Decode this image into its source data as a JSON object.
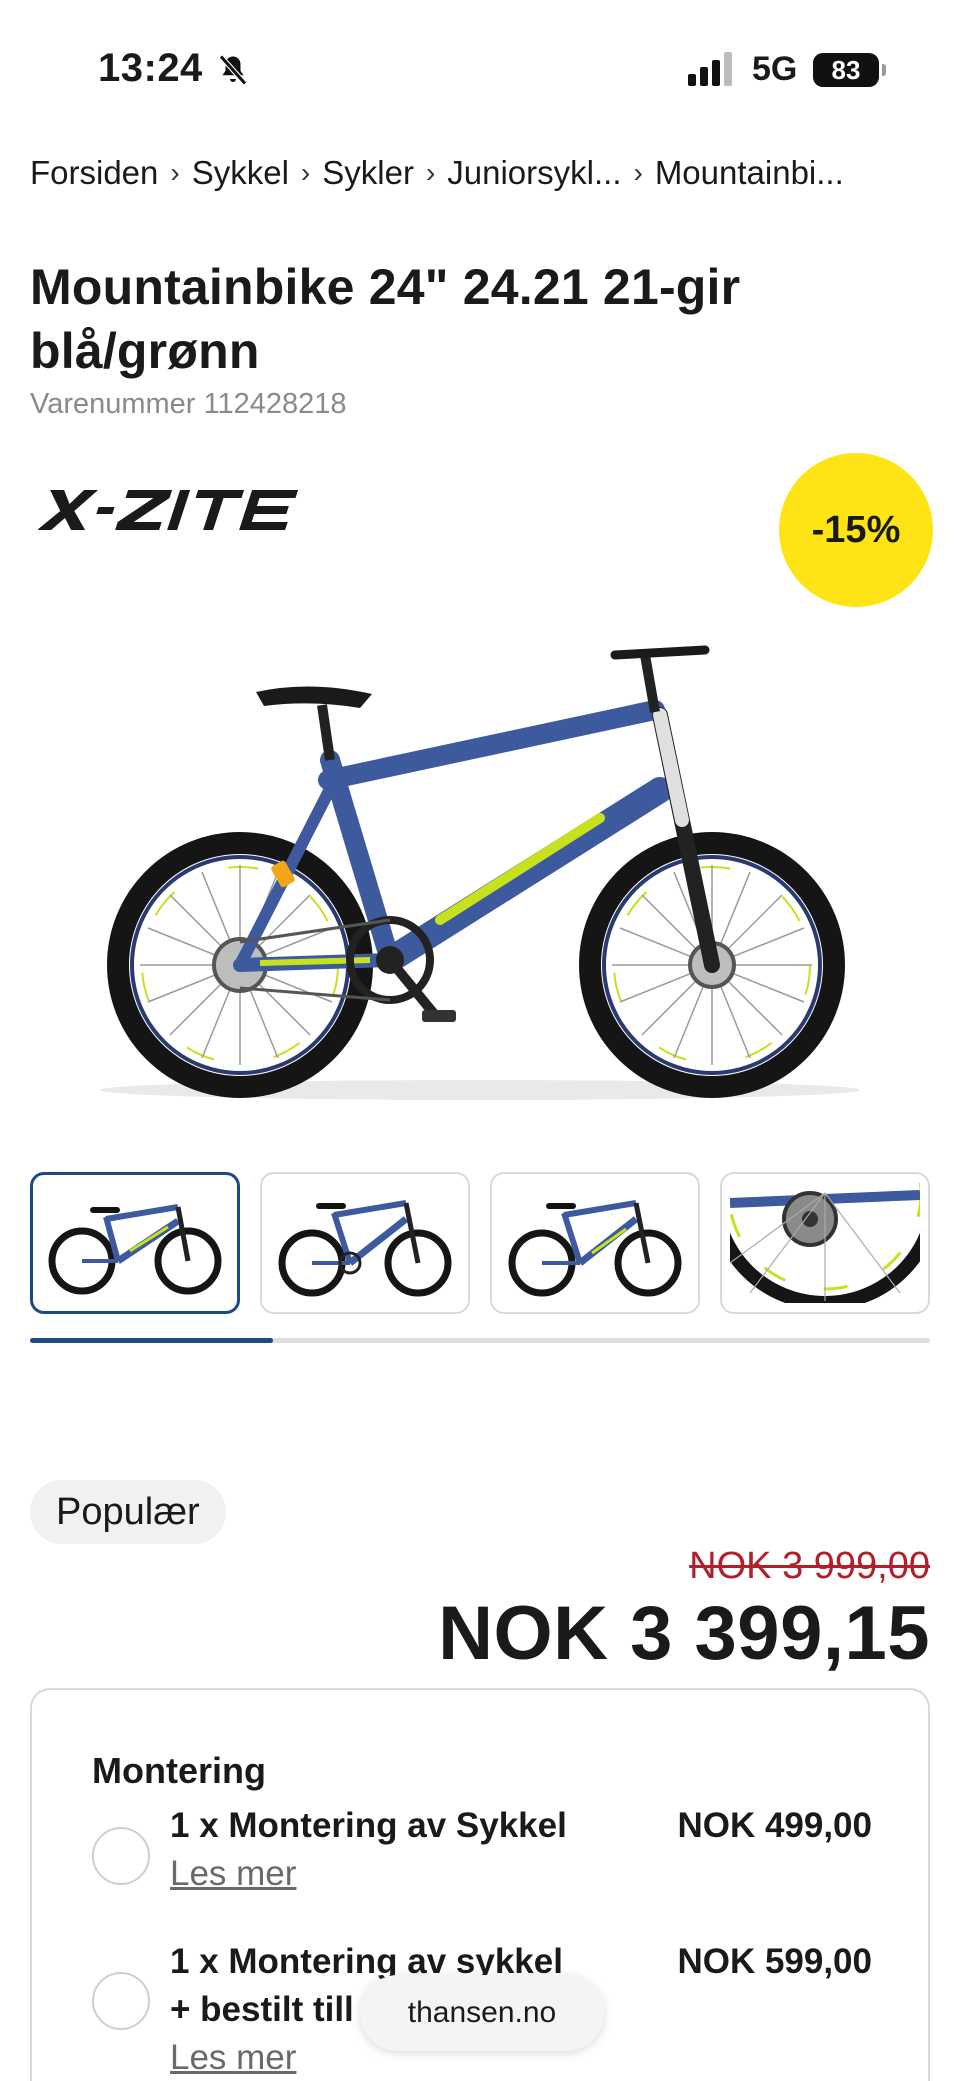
{
  "status_bar": {
    "time": "13:24",
    "network": "5G",
    "battery": "83",
    "icons": [
      "bell-slash-icon",
      "signal-icon",
      "battery-icon"
    ]
  },
  "breadcrumb": {
    "items": [
      "Forsiden",
      "Sykkel",
      "Sykler",
      "Juniorsykl...",
      "Mountainbi..."
    ],
    "separator": "›"
  },
  "product": {
    "title": "Mountainbike 24\" 24.21 21-gir blå/grønn",
    "sku_label": "Varenummer",
    "sku": "112428218",
    "brand": "X-ZITE",
    "discount_badge": "-15%",
    "popular_badge": "Populær",
    "old_price": "NOK 3 999,00",
    "price": "NOK 3 399,15"
  },
  "gallery": {
    "thumbnails": [
      "bike-side-view",
      "bike-side-view",
      "bike-side-view",
      "bike-gear-closeup"
    ],
    "active_index": 0,
    "scroll_progress": 0.27
  },
  "assembly": {
    "title": "Montering",
    "options": [
      {
        "name_line1": "1 x Montering av Sykkel",
        "name_line2": "",
        "link": "Les mer",
        "price": "NOK 499,00"
      },
      {
        "name_line1": "1 x Montering av sykkel",
        "name_line2": "+ bestilt till",
        "link": "Les mer",
        "price": "NOK 599,00"
      }
    ]
  },
  "browser": {
    "url": "thansen.no"
  },
  "colors": {
    "accent_blue": "#1d4a85",
    "discount_yellow": "#ffe415",
    "old_price_red": "#b0202a",
    "bike_frame_blue": "#3d5a9e",
    "bike_lime": "#c8e11f"
  }
}
